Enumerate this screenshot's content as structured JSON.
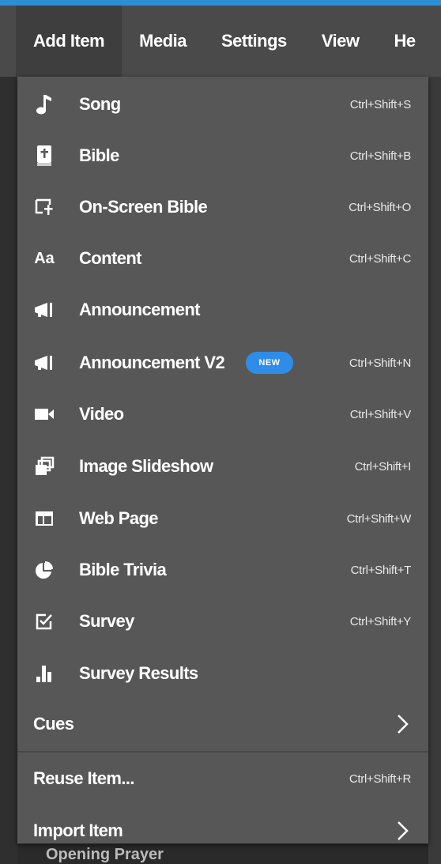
{
  "menubar": {
    "items": [
      "Add Item",
      "Media",
      "Settings",
      "View",
      "He"
    ]
  },
  "menu": {
    "items": [
      {
        "label": "Song",
        "shortcut": "Ctrl+Shift+S",
        "icon": "music-note-icon"
      },
      {
        "label": "Bible",
        "shortcut": "Ctrl+Shift+B",
        "icon": "bible-icon"
      },
      {
        "label": "On-Screen Bible",
        "shortcut": "Ctrl+Shift+O",
        "icon": "onscreen-bible-icon"
      },
      {
        "label": "Content",
        "shortcut": "Ctrl+Shift+C",
        "icon": "text-aa-icon"
      },
      {
        "label": "Announcement",
        "shortcut": "",
        "icon": "megaphone-icon"
      },
      {
        "label": "Announcement V2",
        "shortcut": "Ctrl+Shift+N",
        "icon": "megaphone-icon",
        "badge": "NEW"
      },
      {
        "label": "Video",
        "shortcut": "Ctrl+Shift+V",
        "icon": "video-camera-icon"
      },
      {
        "label": "Image Slideshow",
        "shortcut": "Ctrl+Shift+I",
        "icon": "slideshow-icon"
      },
      {
        "label": "Web Page",
        "shortcut": "Ctrl+Shift+W",
        "icon": "web-page-icon"
      },
      {
        "label": "Bible Trivia",
        "shortcut": "Ctrl+Shift+T",
        "icon": "pie-chart-icon"
      },
      {
        "label": "Survey",
        "shortcut": "Ctrl+Shift+Y",
        "icon": "survey-checkbox-icon"
      },
      {
        "label": "Survey Results",
        "shortcut": "",
        "icon": "bar-chart-icon"
      }
    ],
    "cues": {
      "label": "Cues"
    },
    "reuse": {
      "label": "Reuse Item...",
      "shortcut": "Ctrl+Shift+R"
    },
    "import": {
      "label": "Import Item"
    }
  },
  "background": {
    "bottom_text": "Opening Prayer"
  },
  "colors": {
    "accent": "#2b8fd6",
    "badge": "#2f8de8",
    "menu_bg": "#575757",
    "menubar_bg": "#4a4a4a"
  }
}
